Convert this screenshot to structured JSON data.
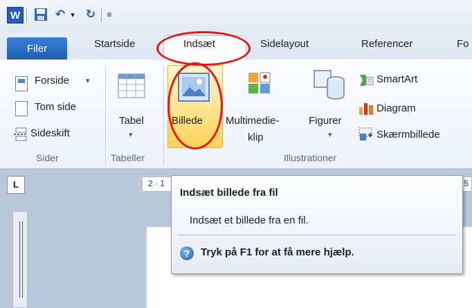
{
  "tabs": {
    "file": "Filer",
    "home": "Startside",
    "insert": "Indsæt",
    "layout": "Sidelayout",
    "references": "Referencer",
    "cut": "Fo"
  },
  "pages_group": {
    "cover": "Forside",
    "cover_arrow": "▾",
    "blank": "Tom side",
    "break": "Sideskift",
    "label": "Sider"
  },
  "tables_group": {
    "table": "Tabel",
    "arrow": "▾",
    "label": "Tabeller"
  },
  "illustrations_group": {
    "picture": "Billede",
    "media_1": "Multimedie-",
    "media_2": "klip",
    "shapes": "Figurer",
    "shapes_arrow": "▾",
    "smartart": "SmartArt",
    "chart": "Diagram",
    "screenshot": "Skærmbillede",
    "label": "Illustrationer"
  },
  "ruler": {
    "box": "L",
    "h_marks": "2 · 1",
    "h_end": "5"
  },
  "tooltip": {
    "title": "Indsæt billede fra fil",
    "description": "Indsæt et billede fra en fil.",
    "help": "Tryk på F1 for at få mere hjælp."
  },
  "colors": {
    "accent": "#1e5fb5",
    "highlight": "#e21a1a",
    "selected": "#ffd35a"
  }
}
